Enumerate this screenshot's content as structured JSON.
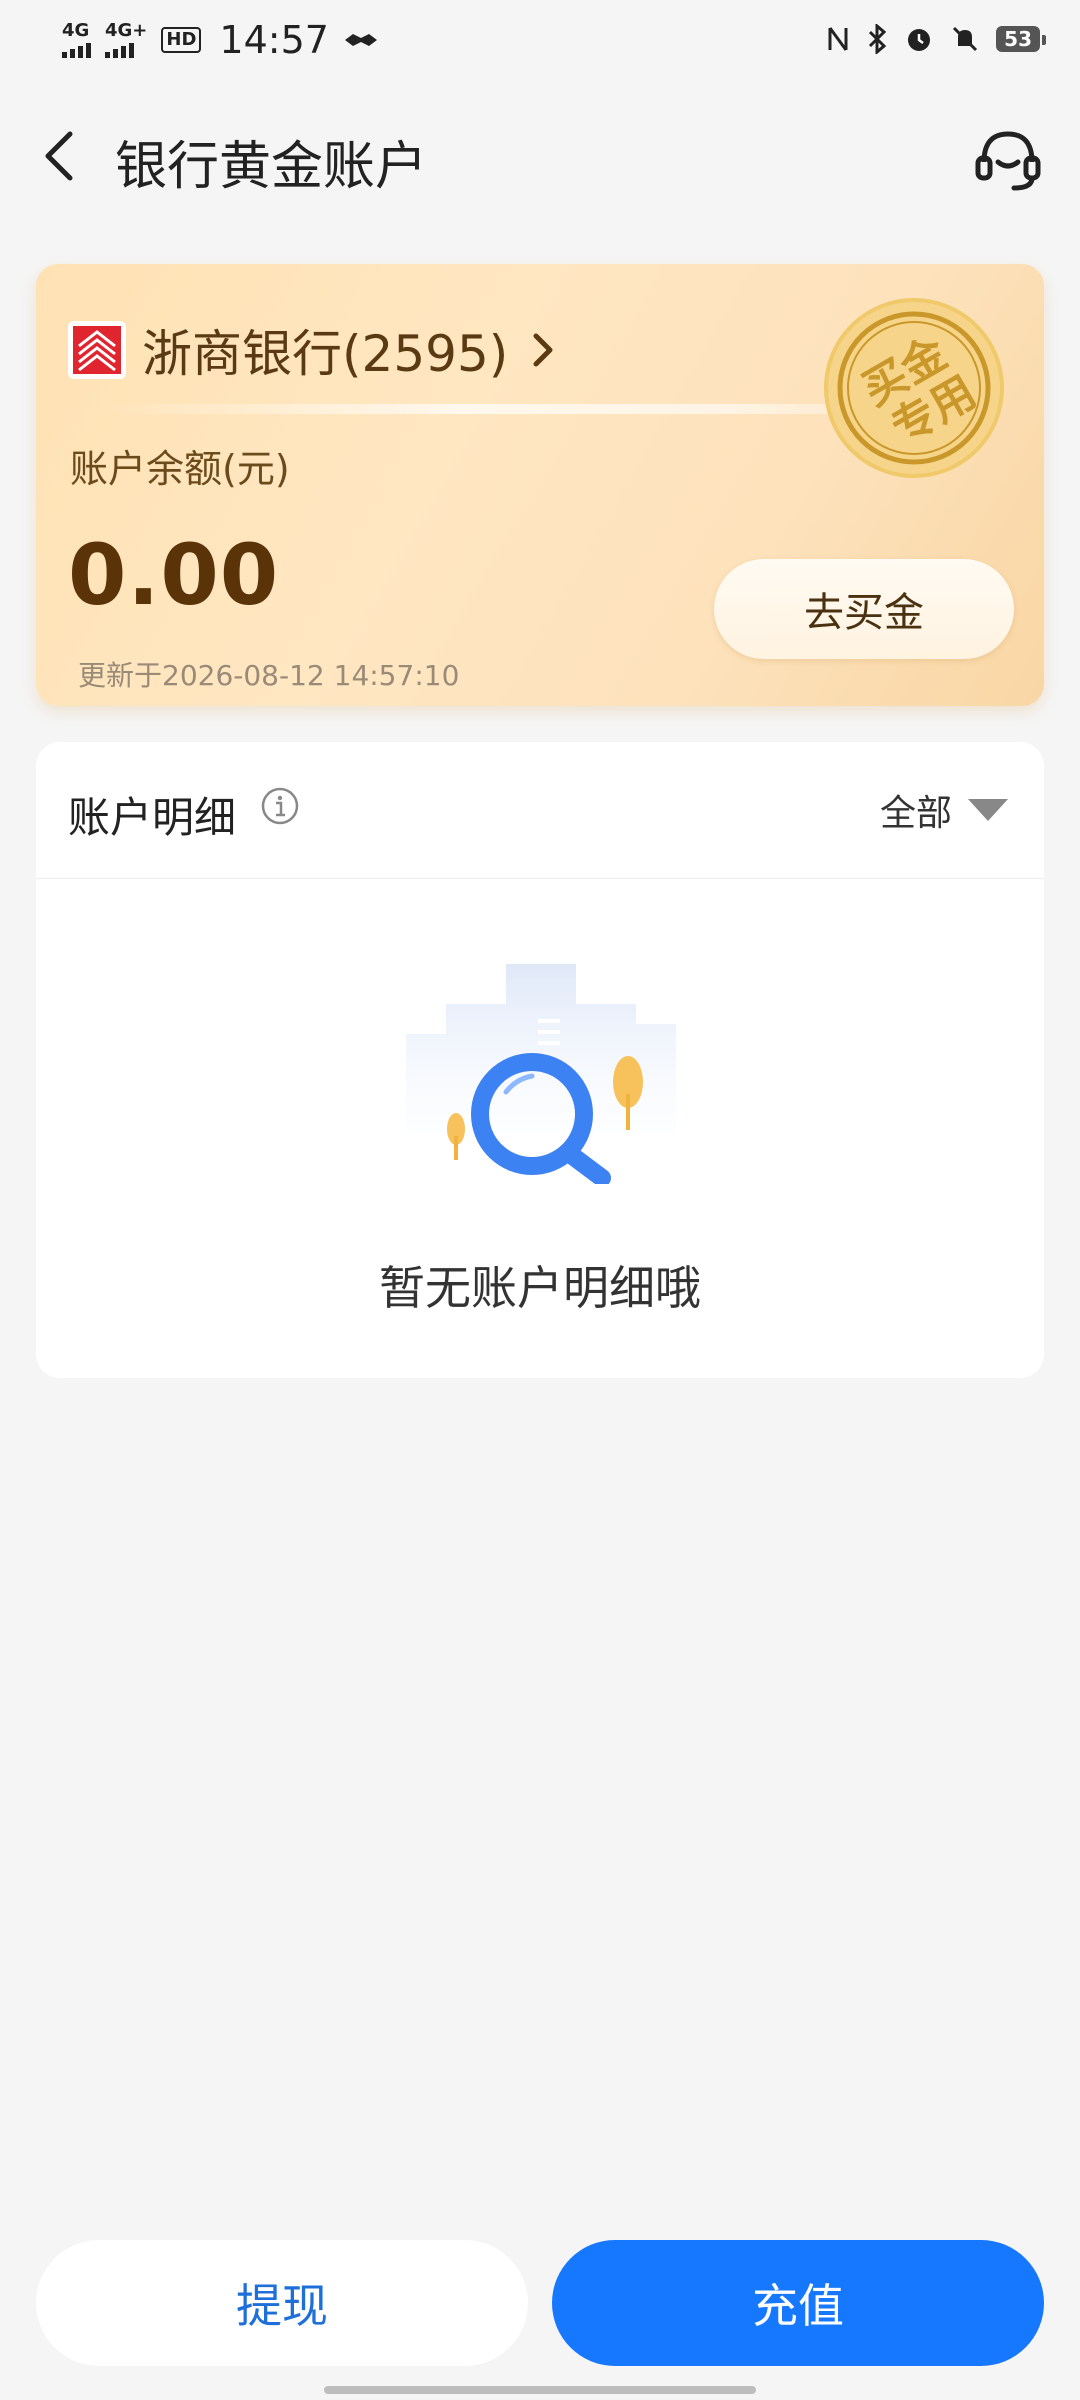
{
  "status_bar": {
    "signal1": "4G",
    "signal2": "4G+",
    "hd": "HD",
    "time": "14:57",
    "battery": "53",
    "icons": [
      "nfc-icon",
      "bluetooth-icon",
      "alarm-icon",
      "mute-icon"
    ]
  },
  "header": {
    "title": "银行黄金账户"
  },
  "card": {
    "bank_name": "浙商银行(2595)",
    "stamp_text": "买金专用",
    "balance_label": "账户余额(元)",
    "balance_value": "0.00",
    "updated": "更新于2026-08-12 14:57:10",
    "buy_button": "去买金"
  },
  "details": {
    "title": "账户明细",
    "filter": "全部",
    "empty_text": "暂无账户明细哦"
  },
  "actions": {
    "withdraw": "提现",
    "recharge": "充值"
  },
  "colors": {
    "primary": "#1677ff",
    "card_gold": "#ffe2b4",
    "balance_text": "#5a3408"
  }
}
